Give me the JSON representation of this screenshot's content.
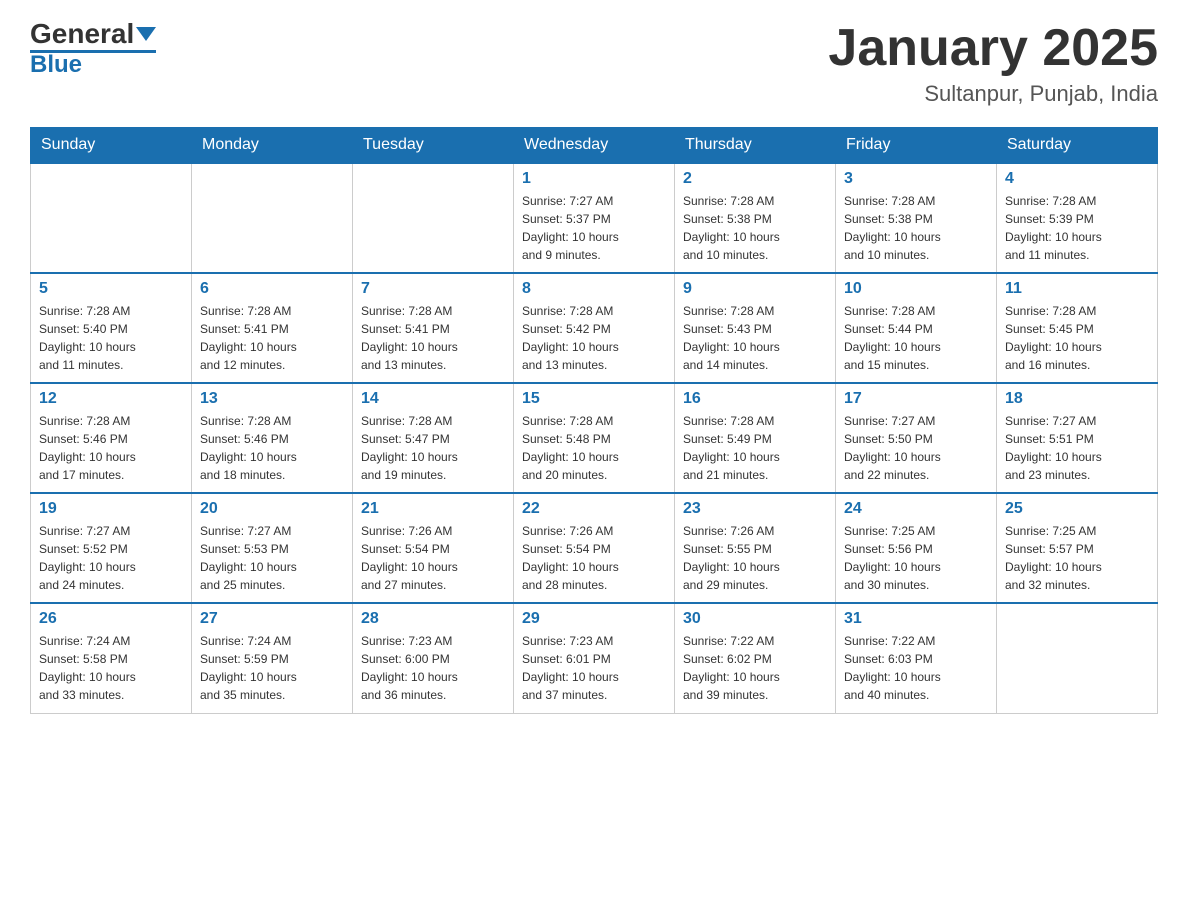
{
  "header": {
    "logo_general": "General",
    "logo_blue": "Blue",
    "month_title": "January 2025",
    "location": "Sultanpur, Punjab, India"
  },
  "days_of_week": [
    "Sunday",
    "Monday",
    "Tuesday",
    "Wednesday",
    "Thursday",
    "Friday",
    "Saturday"
  ],
  "weeks": [
    [
      {
        "day": "",
        "info": ""
      },
      {
        "day": "",
        "info": ""
      },
      {
        "day": "",
        "info": ""
      },
      {
        "day": "1",
        "info": "Sunrise: 7:27 AM\nSunset: 5:37 PM\nDaylight: 10 hours\nand 9 minutes."
      },
      {
        "day": "2",
        "info": "Sunrise: 7:28 AM\nSunset: 5:38 PM\nDaylight: 10 hours\nand 10 minutes."
      },
      {
        "day": "3",
        "info": "Sunrise: 7:28 AM\nSunset: 5:38 PM\nDaylight: 10 hours\nand 10 minutes."
      },
      {
        "day": "4",
        "info": "Sunrise: 7:28 AM\nSunset: 5:39 PM\nDaylight: 10 hours\nand 11 minutes."
      }
    ],
    [
      {
        "day": "5",
        "info": "Sunrise: 7:28 AM\nSunset: 5:40 PM\nDaylight: 10 hours\nand 11 minutes."
      },
      {
        "day": "6",
        "info": "Sunrise: 7:28 AM\nSunset: 5:41 PM\nDaylight: 10 hours\nand 12 minutes."
      },
      {
        "day": "7",
        "info": "Sunrise: 7:28 AM\nSunset: 5:41 PM\nDaylight: 10 hours\nand 13 minutes."
      },
      {
        "day": "8",
        "info": "Sunrise: 7:28 AM\nSunset: 5:42 PM\nDaylight: 10 hours\nand 13 minutes."
      },
      {
        "day": "9",
        "info": "Sunrise: 7:28 AM\nSunset: 5:43 PM\nDaylight: 10 hours\nand 14 minutes."
      },
      {
        "day": "10",
        "info": "Sunrise: 7:28 AM\nSunset: 5:44 PM\nDaylight: 10 hours\nand 15 minutes."
      },
      {
        "day": "11",
        "info": "Sunrise: 7:28 AM\nSunset: 5:45 PM\nDaylight: 10 hours\nand 16 minutes."
      }
    ],
    [
      {
        "day": "12",
        "info": "Sunrise: 7:28 AM\nSunset: 5:46 PM\nDaylight: 10 hours\nand 17 minutes."
      },
      {
        "day": "13",
        "info": "Sunrise: 7:28 AM\nSunset: 5:46 PM\nDaylight: 10 hours\nand 18 minutes."
      },
      {
        "day": "14",
        "info": "Sunrise: 7:28 AM\nSunset: 5:47 PM\nDaylight: 10 hours\nand 19 minutes."
      },
      {
        "day": "15",
        "info": "Sunrise: 7:28 AM\nSunset: 5:48 PM\nDaylight: 10 hours\nand 20 minutes."
      },
      {
        "day": "16",
        "info": "Sunrise: 7:28 AM\nSunset: 5:49 PM\nDaylight: 10 hours\nand 21 minutes."
      },
      {
        "day": "17",
        "info": "Sunrise: 7:27 AM\nSunset: 5:50 PM\nDaylight: 10 hours\nand 22 minutes."
      },
      {
        "day": "18",
        "info": "Sunrise: 7:27 AM\nSunset: 5:51 PM\nDaylight: 10 hours\nand 23 minutes."
      }
    ],
    [
      {
        "day": "19",
        "info": "Sunrise: 7:27 AM\nSunset: 5:52 PM\nDaylight: 10 hours\nand 24 minutes."
      },
      {
        "day": "20",
        "info": "Sunrise: 7:27 AM\nSunset: 5:53 PM\nDaylight: 10 hours\nand 25 minutes."
      },
      {
        "day": "21",
        "info": "Sunrise: 7:26 AM\nSunset: 5:54 PM\nDaylight: 10 hours\nand 27 minutes."
      },
      {
        "day": "22",
        "info": "Sunrise: 7:26 AM\nSunset: 5:54 PM\nDaylight: 10 hours\nand 28 minutes."
      },
      {
        "day": "23",
        "info": "Sunrise: 7:26 AM\nSunset: 5:55 PM\nDaylight: 10 hours\nand 29 minutes."
      },
      {
        "day": "24",
        "info": "Sunrise: 7:25 AM\nSunset: 5:56 PM\nDaylight: 10 hours\nand 30 minutes."
      },
      {
        "day": "25",
        "info": "Sunrise: 7:25 AM\nSunset: 5:57 PM\nDaylight: 10 hours\nand 32 minutes."
      }
    ],
    [
      {
        "day": "26",
        "info": "Sunrise: 7:24 AM\nSunset: 5:58 PM\nDaylight: 10 hours\nand 33 minutes."
      },
      {
        "day": "27",
        "info": "Sunrise: 7:24 AM\nSunset: 5:59 PM\nDaylight: 10 hours\nand 35 minutes."
      },
      {
        "day": "28",
        "info": "Sunrise: 7:23 AM\nSunset: 6:00 PM\nDaylight: 10 hours\nand 36 minutes."
      },
      {
        "day": "29",
        "info": "Sunrise: 7:23 AM\nSunset: 6:01 PM\nDaylight: 10 hours\nand 37 minutes."
      },
      {
        "day": "30",
        "info": "Sunrise: 7:22 AM\nSunset: 6:02 PM\nDaylight: 10 hours\nand 39 minutes."
      },
      {
        "day": "31",
        "info": "Sunrise: 7:22 AM\nSunset: 6:03 PM\nDaylight: 10 hours\nand 40 minutes."
      },
      {
        "day": "",
        "info": ""
      }
    ]
  ]
}
